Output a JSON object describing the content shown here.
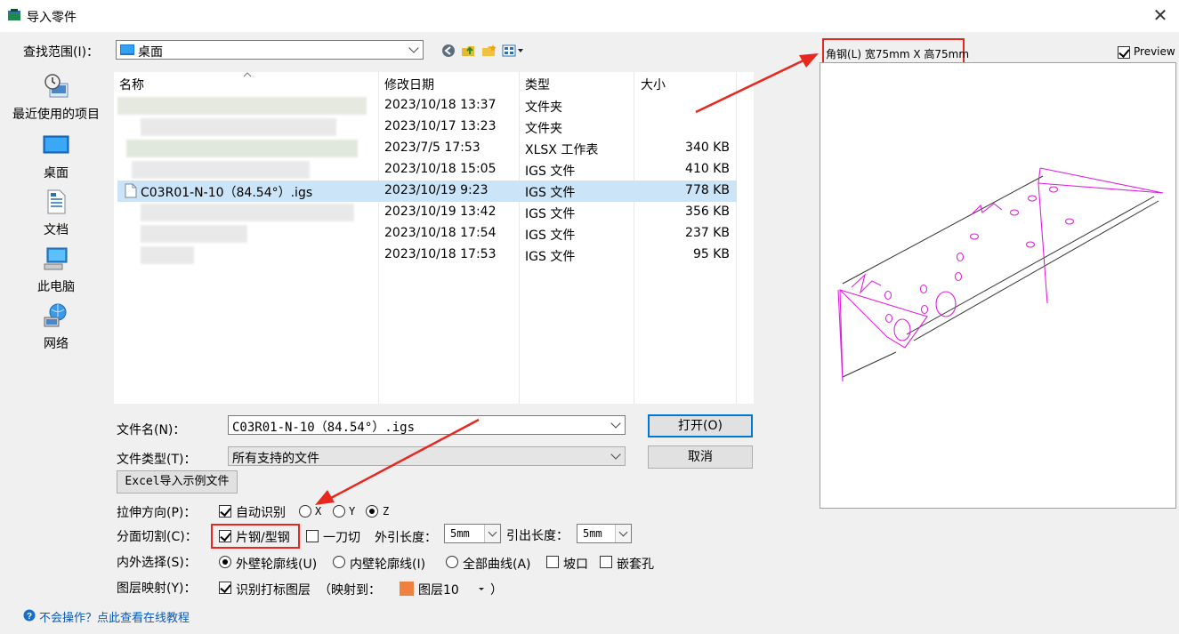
{
  "window": {
    "title": "导入零件",
    "close_glyph": "✕"
  },
  "lookin": {
    "label": "查找范围(I)：",
    "value": "桌面"
  },
  "places": [
    {
      "label": "最近使用的项目",
      "icon": "recent-items-icon"
    },
    {
      "label": "桌面",
      "icon": "desktop-icon"
    },
    {
      "label": "文档",
      "icon": "documents-icon"
    },
    {
      "label": "此电脑",
      "icon": "computer-icon"
    },
    {
      "label": "网络",
      "icon": "network-icon"
    }
  ],
  "file_list": {
    "columns": [
      "名称",
      "修改日期",
      "类型",
      "大小"
    ],
    "rows": [
      {
        "name": "",
        "date": "2023/10/18 13:37",
        "type": "文件夹",
        "size": ""
      },
      {
        "name": "",
        "date": "2023/10/17 13:23",
        "type": "文件夹",
        "size": ""
      },
      {
        "name": "",
        "date": "2023/7/5 17:53",
        "type": "XLSX 工作表",
        "size": "340 KB"
      },
      {
        "name": "",
        "date": "2023/10/18 15:05",
        "type": "IGS 文件",
        "size": "410 KB"
      },
      {
        "name": "C03R01-N-10（84.54°）.igs",
        "date": "2023/10/19 9:23",
        "type": "IGS 文件",
        "size": "778 KB",
        "selected": true
      },
      {
        "name": "",
        "date": "2023/10/19 13:42",
        "type": "IGS 文件",
        "size": "356 KB"
      },
      {
        "name": "",
        "date": "2023/10/18 17:54",
        "type": "IGS 文件",
        "size": "237 KB"
      },
      {
        "name": "",
        "date": "2023/10/18 17:53",
        "type": "IGS 文件",
        "size": "95 KB"
      }
    ]
  },
  "filename": {
    "label": "文件名(N)：",
    "value": "C03R01-N-10（84.54°）.igs"
  },
  "filetype": {
    "label": "文件类型(T)：",
    "value": "所有支持的文件"
  },
  "buttons": {
    "open": "打开(O)",
    "cancel": "取消",
    "excel_example": "Excel导入示例文件"
  },
  "options": {
    "stretch": {
      "label": "拉伸方向(P)：",
      "auto": "自动识别",
      "x": "X",
      "y": "Y",
      "z": "Z"
    },
    "split": {
      "label": "分面切割(C)：",
      "plate": "片钢/型钢",
      "one_cut": "一刀切",
      "outer_len_label": "外引长度：",
      "outer_len": "5mm",
      "lead_len_label": "引出长度：",
      "lead_len": "5mm"
    },
    "inout": {
      "label": "内外选择(S)：",
      "outer": "外壁轮廓线(U)",
      "inner": "内壁轮廓线(I)",
      "all": "全部曲线(A)",
      "bevel": "坡口",
      "nest_hole": "嵌套孔"
    },
    "layer": {
      "label": "图层映射(Y)：",
      "recognize": "识别打标图层",
      "map_prefix": "（映射到：",
      "layer_name": "图层10",
      "map_suffix": "）",
      "layer_color": "#f08040"
    }
  },
  "preview": {
    "info": "角钢(L) 宽75mm X 高75mm",
    "label": "Preview",
    "checked": true
  },
  "help": {
    "text": "不会操作？点此查看在线教程"
  },
  "colors": {
    "selection": "#cce4f7",
    "accent": "#0078d7",
    "annotation_red": "#e8281f",
    "preview_stroke": "#e020e0"
  }
}
